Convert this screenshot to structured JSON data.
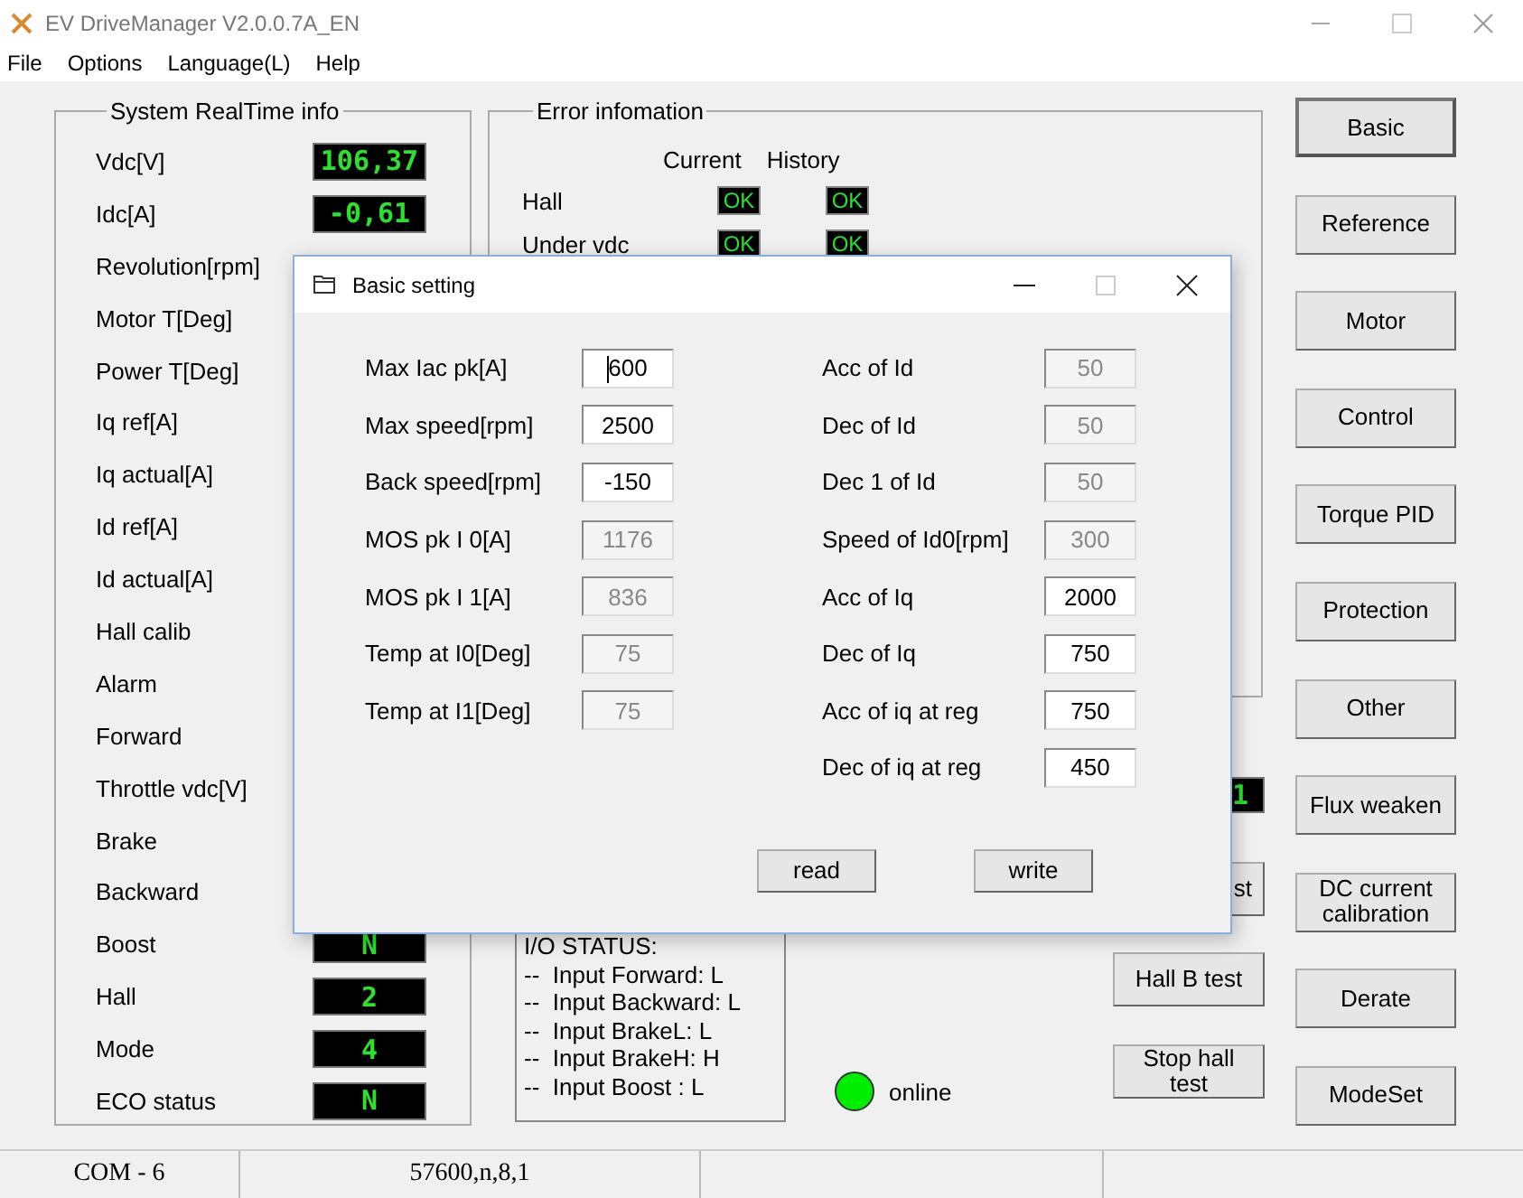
{
  "window": {
    "title": "EV DriveManager V2.0.0.7A_EN"
  },
  "menu": [
    "File",
    "Options",
    "Language(L)",
    "Help"
  ],
  "realtime": {
    "title": "System RealTime info",
    "rows": [
      {
        "label": "Vdc[V]",
        "value": "106,37"
      },
      {
        "label": "Idc[A]",
        "value": "-0,61"
      },
      {
        "label": "Revolution[rpm]"
      },
      {
        "label": "Motor T[Deg]"
      },
      {
        "label": "Power T[Deg]"
      },
      {
        "label": "Iq ref[A]"
      },
      {
        "label": "Iq actual[A]"
      },
      {
        "label": "Id ref[A]"
      },
      {
        "label": "Id actual[A]"
      },
      {
        "label": "Hall calib"
      },
      {
        "label": "Alarm"
      },
      {
        "label": "Forward"
      },
      {
        "label": "Throttle vdc[V]"
      },
      {
        "label": "Brake"
      },
      {
        "label": "Backward"
      },
      {
        "label": "Boost",
        "value": "N"
      },
      {
        "label": "Hall",
        "value": "2"
      },
      {
        "label": "Mode",
        "value": "4"
      },
      {
        "label": "ECO status",
        "value": "N"
      }
    ]
  },
  "errors": {
    "title": "Error infomation",
    "columns": [
      "Current",
      "History"
    ],
    "rows": [
      {
        "label": "Hall",
        "current": "OK",
        "history": "OK"
      },
      {
        "label": "Under vdc",
        "current": "OK",
        "history": "OK"
      }
    ]
  },
  "io_status": [
    "I/O STATUS:",
    "--  Input Forward: L",
    "--  Input Backward: L",
    "--  Input BrakeL: L",
    "--  Input BrakeH: H",
    "--  Input Boost : L"
  ],
  "connection": {
    "label": "online",
    "on": true
  },
  "partial_display": {
    "value": "1"
  },
  "test_buttons": [
    "st",
    "Hall B test",
    "Stop hall test"
  ],
  "side_buttons": [
    {
      "label": "Basic",
      "selected": true
    },
    {
      "label": "Reference",
      "selected": false
    },
    {
      "label": "Motor",
      "selected": false
    },
    {
      "label": "Control",
      "selected": false
    },
    {
      "label": "Torque PID",
      "selected": false
    },
    {
      "label": "Protection",
      "selected": false
    },
    {
      "label": "Other",
      "selected": false
    },
    {
      "label": "Flux weaken",
      "selected": false
    },
    {
      "label": "DC current calibration",
      "selected": false
    },
    {
      "label": "Derate",
      "selected": false
    },
    {
      "label": "ModeSet",
      "selected": false
    }
  ],
  "status_bar": [
    "COM - 6",
    "57600,n,8,1"
  ],
  "dialog": {
    "title": "Basic setting",
    "left_fields": [
      {
        "label": "Max Iac pk[A]",
        "value": "600",
        "disabled": false,
        "focused": true
      },
      {
        "label": "Max speed[rpm]",
        "value": "2500",
        "disabled": false,
        "focused": false
      },
      {
        "label": "Back speed[rpm]",
        "value": "-150",
        "disabled": false,
        "focused": false
      },
      {
        "label": "MOS pk I 0[A]",
        "value": "1176",
        "disabled": true,
        "focused": false
      },
      {
        "label": "MOS pk I 1[A]",
        "value": "836",
        "disabled": true,
        "focused": false
      },
      {
        "label": "Temp at I0[Deg]",
        "value": "75",
        "disabled": true,
        "focused": false
      },
      {
        "label": "Temp at I1[Deg]",
        "value": "75",
        "disabled": true,
        "focused": false
      }
    ],
    "right_fields": [
      {
        "label": "Acc of Id",
        "value": "50",
        "disabled": true,
        "focused": false
      },
      {
        "label": "Dec of Id",
        "value": "50",
        "disabled": true,
        "focused": false
      },
      {
        "label": "Dec 1 of Id",
        "value": "50",
        "disabled": true,
        "focused": false
      },
      {
        "label": "Speed of Id0[rpm]",
        "value": "300",
        "disabled": true,
        "focused": false
      },
      {
        "label": "Acc of Iq",
        "value": "2000",
        "disabled": false,
        "focused": false
      },
      {
        "label": "Dec of Iq",
        "value": "750",
        "disabled": false,
        "focused": false
      },
      {
        "label": "Acc of iq at reg",
        "value": "750",
        "disabled": false,
        "focused": false
      },
      {
        "label": "Dec of iq at reg",
        "value": "450",
        "disabled": false,
        "focused": false
      }
    ],
    "buttons": [
      "read",
      "write"
    ]
  }
}
